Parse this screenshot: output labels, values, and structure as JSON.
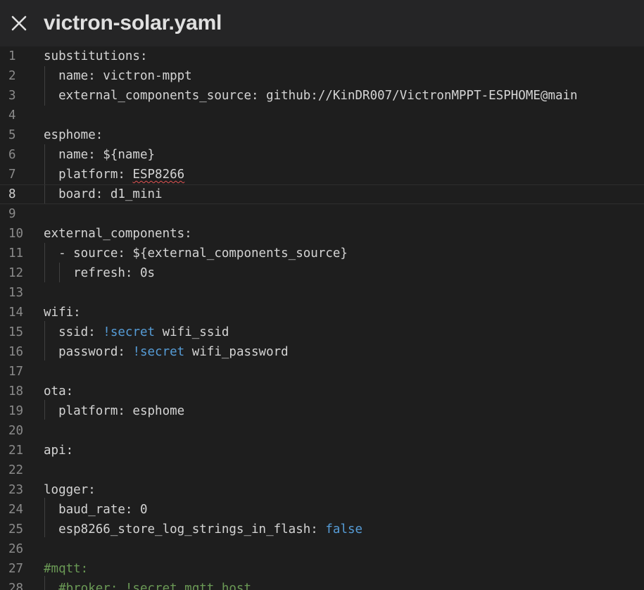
{
  "window": {
    "title": "victron-solar.yaml",
    "close_icon": "close-icon"
  },
  "editor": {
    "active_line": 8,
    "lines": [
      {
        "n": "1",
        "segments": [
          {
            "t": "substitutions:",
            "c": "plain"
          }
        ]
      },
      {
        "n": "2",
        "segments": [
          {
            "t": "  name: victron-mppt",
            "c": "plain"
          }
        ]
      },
      {
        "n": "3",
        "segments": [
          {
            "t": "  external_components_source: github://KinDR007/VictronMPPT-ESPHOME@main",
            "c": "plain"
          }
        ]
      },
      {
        "n": "4",
        "segments": []
      },
      {
        "n": "5",
        "segments": [
          {
            "t": "esphome:",
            "c": "plain"
          }
        ]
      },
      {
        "n": "6",
        "segments": [
          {
            "t": "  name: ${name}",
            "c": "plain"
          }
        ]
      },
      {
        "n": "7",
        "segments": [
          {
            "t": "  platform: ",
            "c": "plain"
          },
          {
            "t": "ESP8266",
            "c": "squiggle"
          }
        ]
      },
      {
        "n": "8",
        "segments": [
          {
            "t": "  board: d1_mini",
            "c": "plain"
          }
        ]
      },
      {
        "n": "9",
        "segments": []
      },
      {
        "n": "10",
        "segments": [
          {
            "t": "external_components:",
            "c": "plain"
          }
        ]
      },
      {
        "n": "11",
        "segments": [
          {
            "t": "  - source: ${external_components_source}",
            "c": "plain"
          }
        ]
      },
      {
        "n": "12",
        "segments": [
          {
            "t": "    refresh: 0s",
            "c": "plain"
          }
        ]
      },
      {
        "n": "13",
        "segments": []
      },
      {
        "n": "14",
        "segments": [
          {
            "t": "wifi:",
            "c": "plain"
          }
        ]
      },
      {
        "n": "15",
        "segments": [
          {
            "t": "  ssid: ",
            "c": "plain"
          },
          {
            "t": "!secret",
            "c": "kw"
          },
          {
            "t": " wifi_ssid",
            "c": "plain"
          }
        ]
      },
      {
        "n": "16",
        "segments": [
          {
            "t": "  password: ",
            "c": "plain"
          },
          {
            "t": "!secret",
            "c": "kw"
          },
          {
            "t": " wifi_password",
            "c": "plain"
          }
        ]
      },
      {
        "n": "17",
        "segments": []
      },
      {
        "n": "18",
        "segments": [
          {
            "t": "ota:",
            "c": "plain"
          }
        ]
      },
      {
        "n": "19",
        "segments": [
          {
            "t": "  platform: esphome",
            "c": "plain"
          }
        ]
      },
      {
        "n": "20",
        "segments": []
      },
      {
        "n": "21",
        "segments": [
          {
            "t": "api:",
            "c": "plain"
          }
        ]
      },
      {
        "n": "22",
        "segments": []
      },
      {
        "n": "23",
        "segments": [
          {
            "t": "logger:",
            "c": "plain"
          }
        ]
      },
      {
        "n": "24",
        "segments": [
          {
            "t": "  baud_rate: 0",
            "c": "plain"
          }
        ]
      },
      {
        "n": "25",
        "segments": [
          {
            "t": "  esp8266_store_log_strings_in_flash: ",
            "c": "plain"
          },
          {
            "t": "false",
            "c": "kw"
          }
        ]
      },
      {
        "n": "26",
        "segments": []
      },
      {
        "n": "27",
        "segments": [
          {
            "t": "#mqtt:",
            "c": "cm"
          }
        ]
      },
      {
        "n": "28",
        "segments": [
          {
            "t": "  #broker: !secret mqtt_host",
            "c": "cm"
          }
        ]
      }
    ]
  },
  "colors": {
    "background": "#1e1e1e",
    "titlebar": "#252526",
    "text": "#d4d4d4",
    "keyword": "#569cd6",
    "comment": "#6a9955",
    "error_squiggle": "#e05252"
  }
}
